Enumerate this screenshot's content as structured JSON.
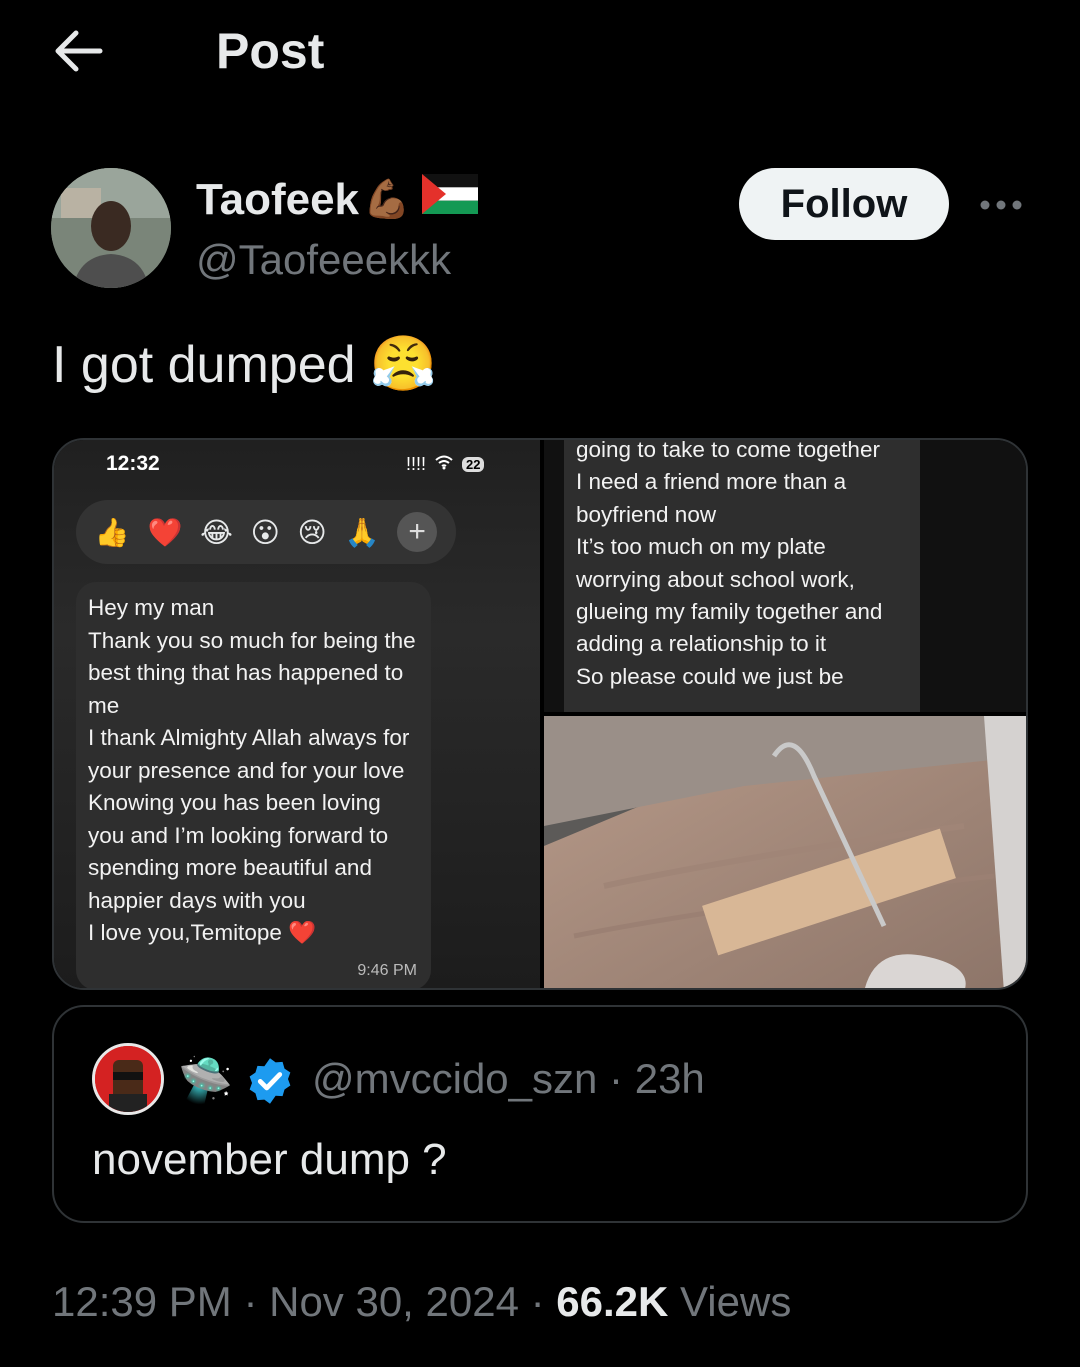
{
  "header": {
    "title": "Post"
  },
  "author": {
    "name": "Taofeek",
    "name_emoji": "💪🏾",
    "flag_icon": "palestine-flag-icon",
    "handle": "@Taofeeekkk",
    "follow_label": "Follow"
  },
  "post": {
    "text": "I got dumped",
    "emoji": "😤"
  },
  "media": {
    "left_screenshot": {
      "time": "12:32",
      "signal": "!!!!",
      "battery": "22",
      "reactions": [
        "👍",
        "❤️",
        "😂",
        "😮",
        "😢",
        "🙏"
      ],
      "plus": "+",
      "message": "Hey my man\nThank you so much for being the best thing that has happened to me\nI thank Almighty Allah always for your presence and for your love\nKnowing you has been loving you and I’m looking forward to spending more beautiful and happier days with you\nI love you,Temitope ❤️",
      "message_time": "9:46 PM"
    },
    "right_screenshot": {
      "message": "going to take to come together\nI need a friend more than a boyfriend now\nIt’s too much on my plate worrying about school work, glueing my family together and adding a relationship to it\nSo please could we just be"
    },
    "photo": "iv-drip-arm-photo"
  },
  "quote": {
    "avatar_icon": "cartoon-avatar-icon",
    "emoji": "🛸",
    "verified_icon": "verified-badge-icon",
    "handle": "@mvccido_szn",
    "separator": " · ",
    "age": "23h",
    "text": "november dump ?"
  },
  "footer": {
    "time": "12:39 PM",
    "sep1": " · ",
    "date": "Nov 30, 2024",
    "sep2": " · ",
    "views_count": "66.2K",
    "views_label": " Views"
  }
}
